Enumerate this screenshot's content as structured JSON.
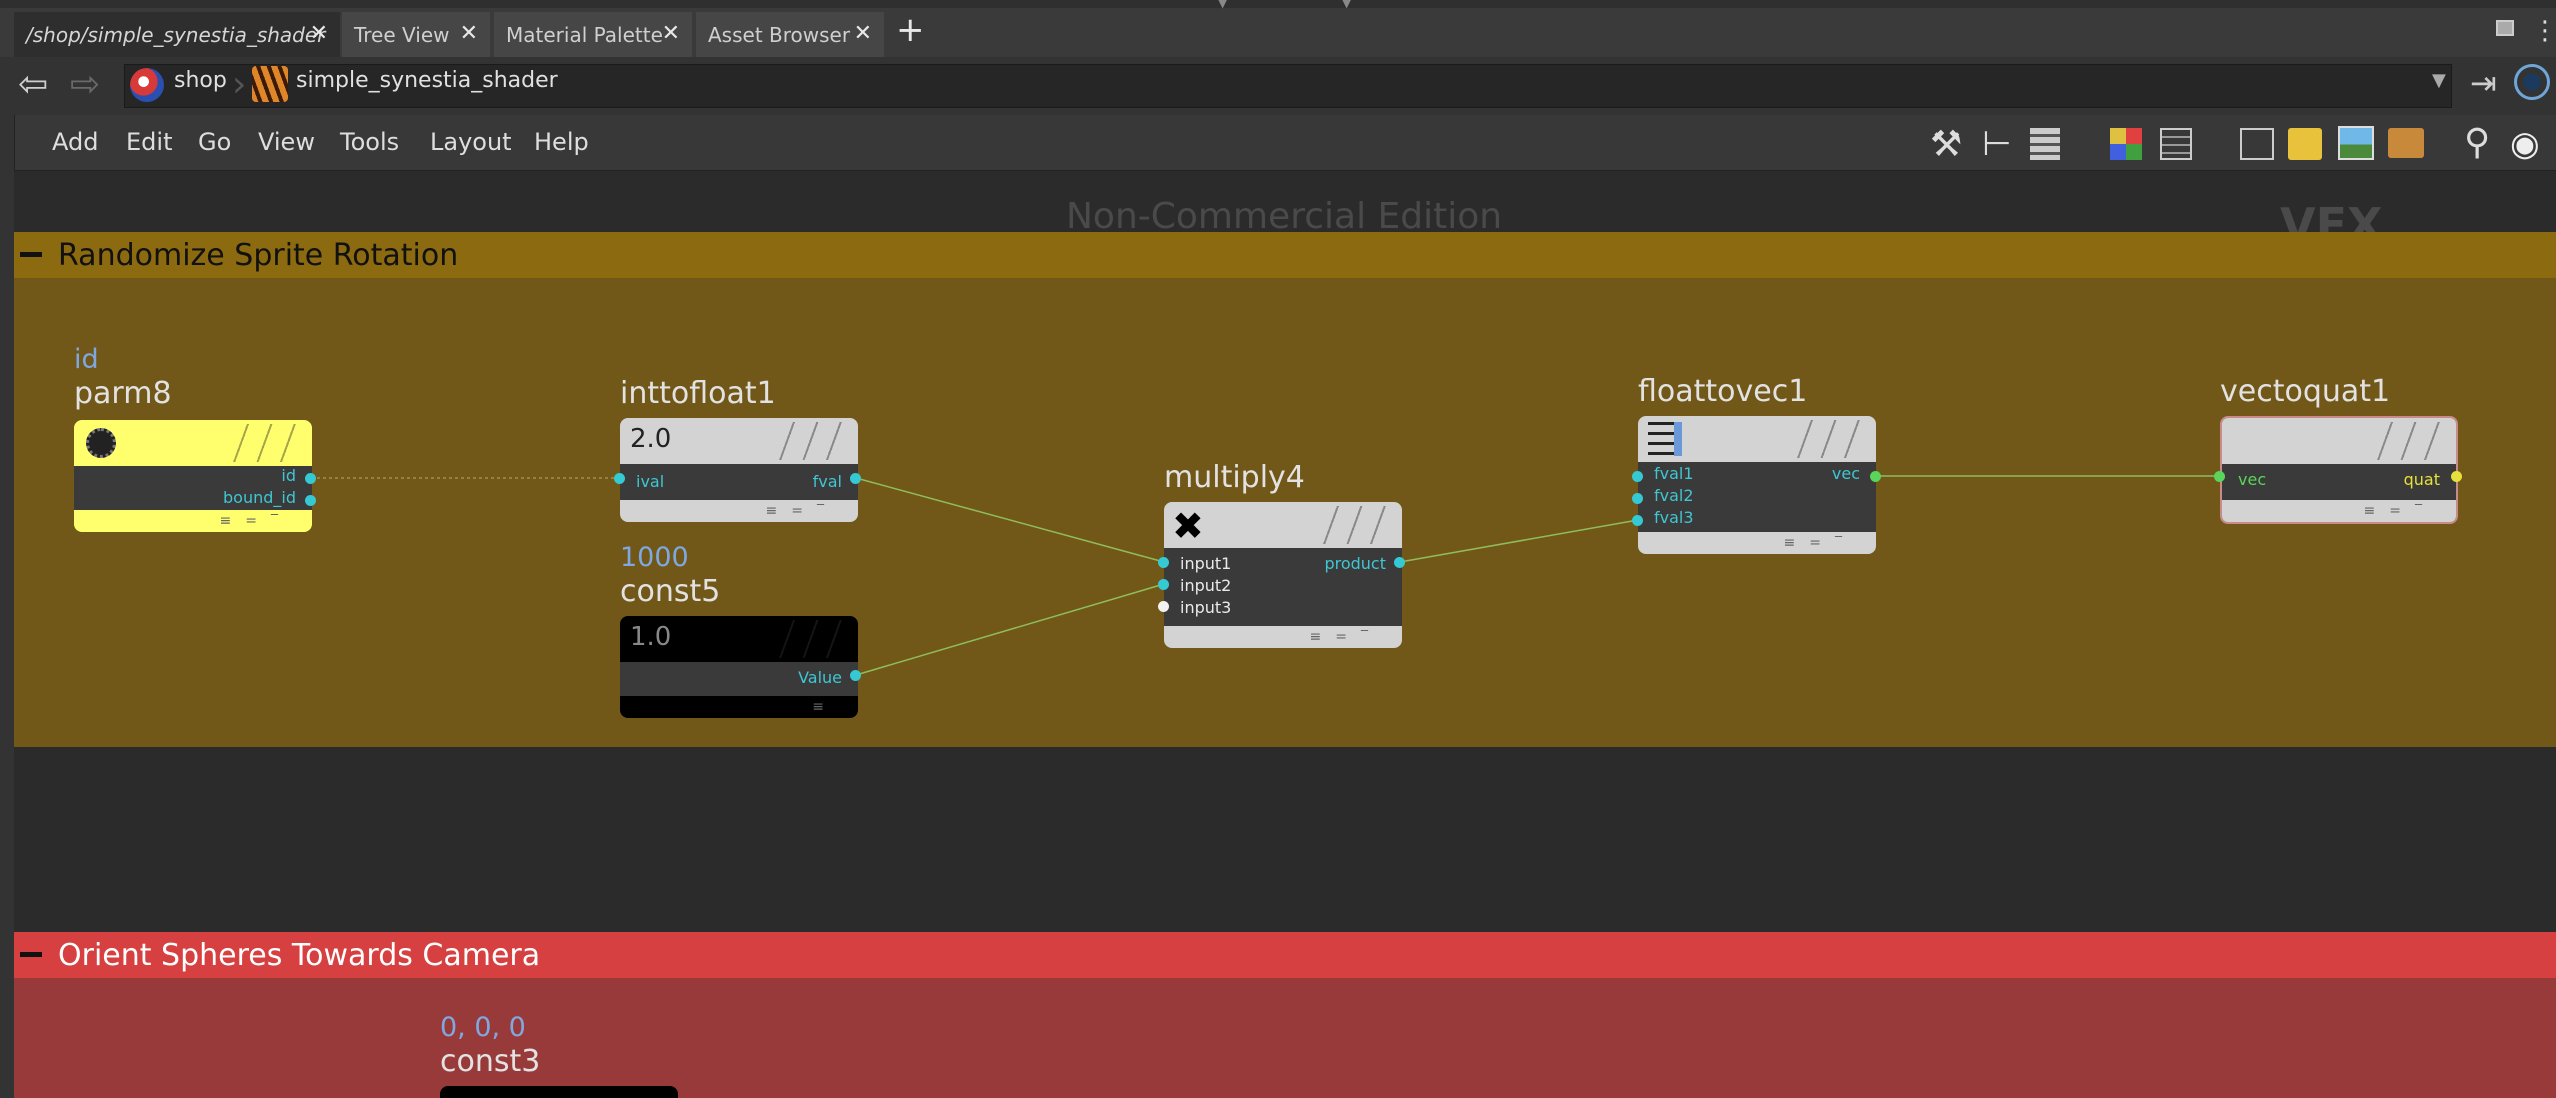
{
  "tabs": [
    {
      "label": "/shop/simple_synestia_shader",
      "active": true
    },
    {
      "label": "Tree View",
      "active": false
    },
    {
      "label": "Material Palette",
      "active": false
    },
    {
      "label": "Asset Browser",
      "active": false
    }
  ],
  "tab_close_glyph": "✕",
  "new_tab_glyph": "+",
  "path": {
    "segments": [
      {
        "label": "shop",
        "icon": "shop-context-icon"
      },
      {
        "label": "simple_synestia_shader",
        "icon": "shader-icon"
      }
    ]
  },
  "menu": [
    "Add",
    "Edit",
    "Go",
    "View",
    "Tools",
    "Layout",
    "Help"
  ],
  "watermarks": {
    "edition": "Non-Commercial Edition",
    "context": "VEX Builder"
  },
  "network_boxes": [
    {
      "title": "Randomize Sprite Rotation",
      "color": "#8c6a10",
      "body_color": "#725818"
    },
    {
      "title": "Orient Spheres Towards Camera",
      "color": "#d64040",
      "body_color": "#993a3a"
    }
  ],
  "nodes": {
    "parm8": {
      "name": "parm8",
      "sub": "id",
      "outputs": [
        "id",
        "bound_id"
      ],
      "color": "#ffff6e"
    },
    "inttofloat1": {
      "name": "inttofloat1",
      "icon_text": "2.0",
      "inputs": [
        "ival"
      ],
      "outputs": [
        "fval"
      ]
    },
    "const5": {
      "name": "const5",
      "sub": "1000",
      "icon_text": "1.0",
      "outputs": [
        "Value"
      ],
      "color": "#000000"
    },
    "multiply4": {
      "name": "multiply4",
      "inputs": [
        "input1",
        "input2",
        "input3"
      ],
      "outputs": [
        "product"
      ]
    },
    "floattovec1": {
      "name": "floattovec1",
      "inputs": [
        "fval1",
        "fval2",
        "fval3"
      ],
      "outputs": [
        "vec"
      ]
    },
    "vectoquat1": {
      "name": "vectoquat1",
      "inputs": [
        "vec"
      ],
      "outputs": [
        "quat"
      ]
    },
    "const3": {
      "name": "const3",
      "sub": "0, 0, 0"
    }
  },
  "colors": {
    "wire": "#8fbd5a",
    "port": "#35c9d4",
    "quat_port": "#e6e03a"
  }
}
